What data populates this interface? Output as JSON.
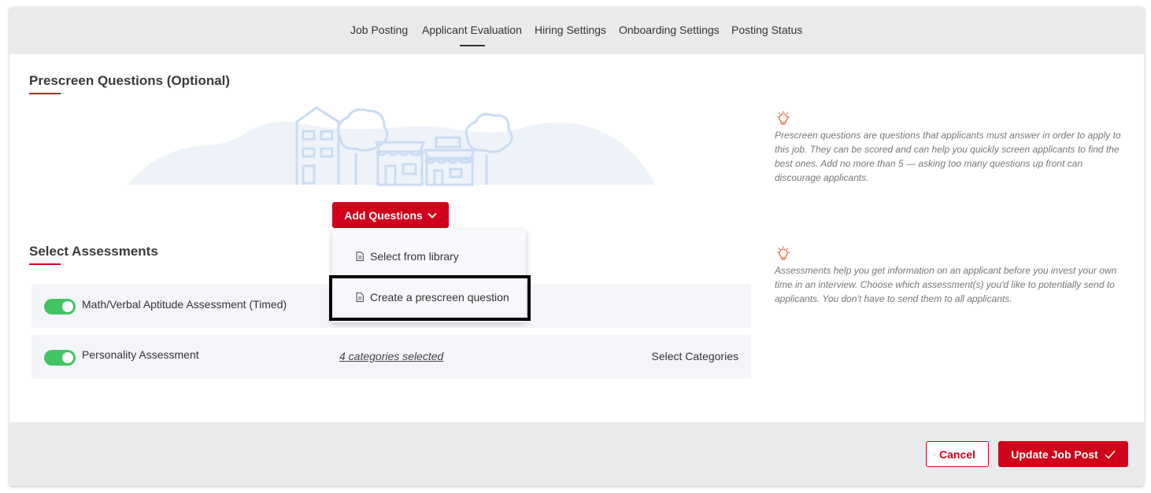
{
  "nav": {
    "tabs": [
      {
        "label": "Job Posting"
      },
      {
        "label": "Applicant Evaluation"
      },
      {
        "label": "Hiring Settings"
      },
      {
        "label": "Onboarding Settings"
      },
      {
        "label": "Posting Status"
      }
    ],
    "active_tab": "Applicant Evaluation"
  },
  "prescreen": {
    "title": "Prescreen Questions (Optional)",
    "add_button_label": "Add Questions",
    "dropdown": [
      {
        "label": "Select from library",
        "icon": "document-icon"
      },
      {
        "label": "Create a prescreen question",
        "icon": "document-icon"
      }
    ],
    "tip": "Prescreen questions are questions that applicants must answer in order to apply to this job. They can be scored and can help you quickly screen applicants to find the best ones. Add no more than 5 — asking too many questions up front can discourage applicants."
  },
  "assessments": {
    "title": "Select Assessments",
    "tip": "Assessments help you get information on an applicant before you invest your own time in an interview. Choose which assessment(s) you'd like to potentially send to applicants. You don't have to send them to all applicants.",
    "rows": [
      {
        "label": "Math/Verbal Aptitude Assessment (Timed)",
        "enabled": true
      },
      {
        "label": "Personality Assessment",
        "enabled": true,
        "categories": "4 categories selected",
        "action": "Select Categories"
      }
    ]
  },
  "footer": {
    "cancel_label": "Cancel",
    "update_label": "Update Job Post"
  },
  "colors": {
    "brand_red": "#d0021b",
    "toggle_on": "#43c463",
    "tip_icon": "#e8643c",
    "illustration": "#c9dcf3"
  }
}
